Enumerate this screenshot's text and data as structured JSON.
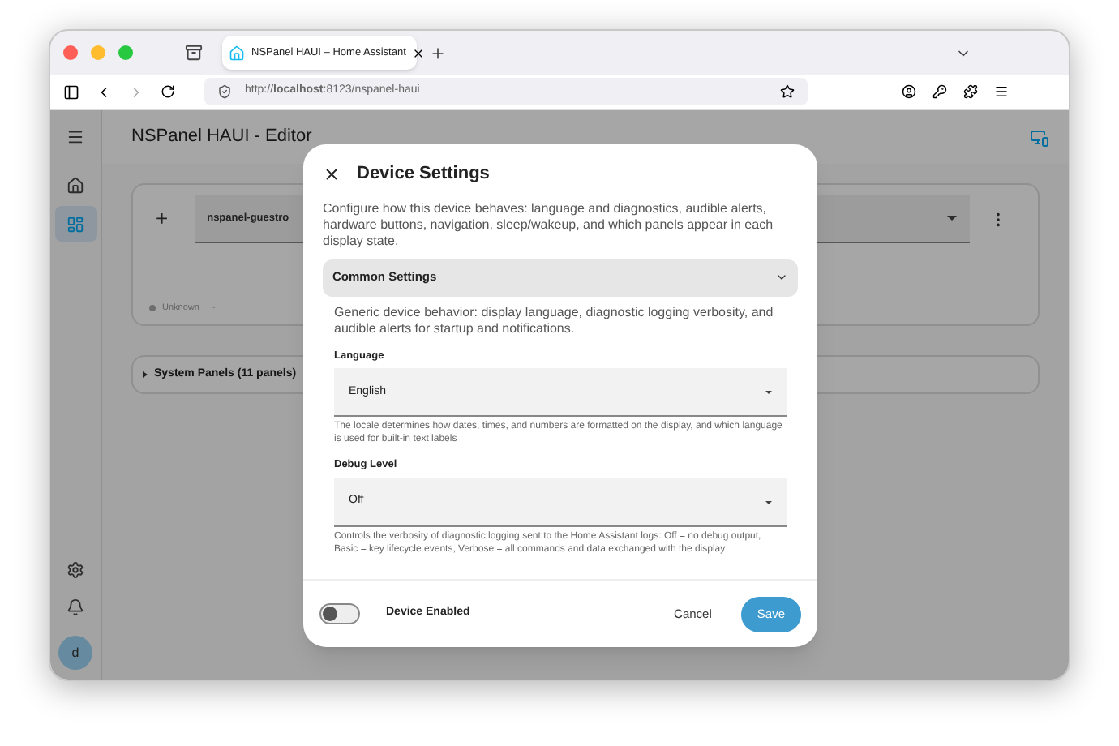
{
  "browser": {
    "tab_title": "NSPanel HAUI – Home Assistant",
    "url": "http://**localhost**:8123/nspanel-haui"
  },
  "app": {
    "title": "NSPanel HAUI - Editor",
    "sidebar": {
      "items": [
        {
          "kind": "home",
          "selected": false
        },
        {
          "kind": "panel",
          "selected": true
        }
      ],
      "bottom_items": [
        {
          "kind": "settings"
        },
        {
          "kind": "bell"
        }
      ],
      "avatar": "d"
    },
    "device_card": {
      "add": "+",
      "device": "nspanel-guestro",
      "status": "Unknown",
      "status_extra": "-"
    },
    "system_panels": {
      "label": "System Panels (11 panels)",
      "expanded": false
    }
  },
  "dialog": {
    "title": "Device Settings",
    "description": "Configure how this device behaves: language and diagnostics, audible alerts, hardware buttons, navigation, sleep/wakeup, and which panels appear in each display state.",
    "section": {
      "title": "Common Settings",
      "expanded": true,
      "description": "Generic device behavior: display language, diagnostic logging verbosity, and audible alerts for startup and notifications."
    },
    "fields": [
      {
        "label": "Language",
        "value": "English",
        "helper": "The locale determines how dates, times, and numbers are formatted on the display, and which language is used for built-in text labels"
      },
      {
        "label": "Debug Level",
        "value": "Off",
        "helper": "Controls the verbosity of diagnostic logging sent to the Home Assistant logs: Off = no debug output, Basic = key lifecycle events, Verbose = all commands and data exchanged with the display"
      }
    ],
    "toggle": {
      "label": "Device Enabled",
      "on": false
    },
    "buttons": [
      {
        "label": "Cancel",
        "kind": "text"
      },
      {
        "label": "Save",
        "kind": "primary"
      }
    ]
  }
}
